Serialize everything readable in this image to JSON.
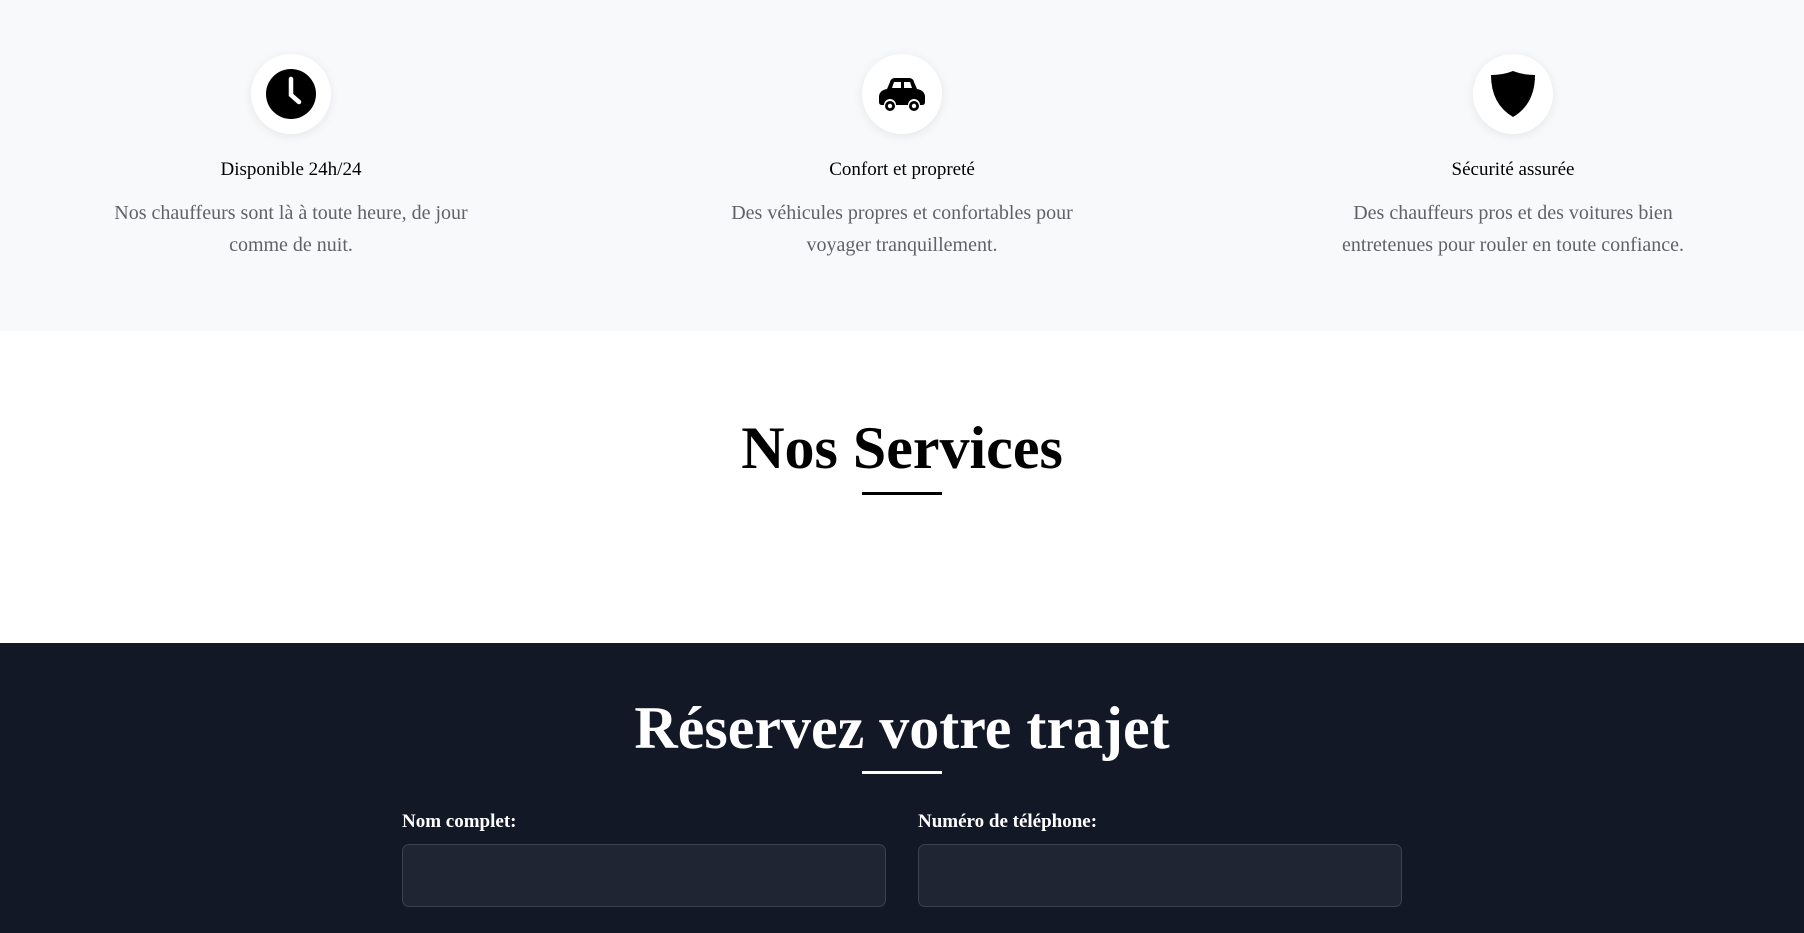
{
  "features": [
    {
      "icon": "clock-icon",
      "title": "Disponible 24h/24",
      "description": "Nos chauffeurs sont là à toute heure, de jour comme de nuit."
    },
    {
      "icon": "car-icon",
      "title": "Confort et propreté",
      "description": "Des véhicules propres et confortables pour voyager tranquillement."
    },
    {
      "icon": "shield-icon",
      "title": "Sécurité assurée",
      "description": "Des chauffeurs pros et des voitures bien entretenues pour rouler en toute confiance."
    }
  ],
  "services": {
    "title": "Nos Services"
  },
  "booking": {
    "title": "Réservez votre trajet",
    "name_label": "Nom complet:",
    "name_value": "",
    "phone_label": "Numéro de téléphone:",
    "phone_value": ""
  },
  "colors": {
    "features_bg": "#f8f9fb",
    "booking_bg": "#131827",
    "input_bg": "#1f2533",
    "muted_text": "#5f6368"
  }
}
